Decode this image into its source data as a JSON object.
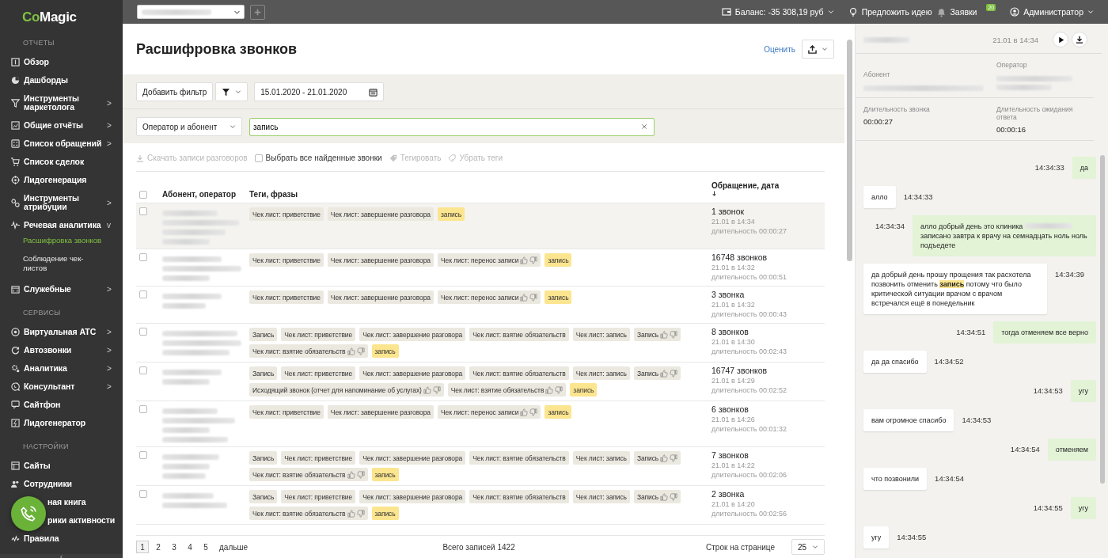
{
  "sidebar": {
    "logo_accent": "Co",
    "logo_rest": "Magic",
    "sections": [
      {
        "title": "ОТЧЕТЫ",
        "items": [
          {
            "label": "Обзор"
          },
          {
            "label": "Дашборды"
          },
          {
            "label": "Инструменты маркетолога",
            "chevron": ">"
          },
          {
            "label": "Общие отчёты",
            "chevron": ">"
          },
          {
            "label": "Список обращений",
            "chevron": ">"
          },
          {
            "label": "Список сделок"
          },
          {
            "label": "Лидогенерация"
          },
          {
            "label": "Инструменты атрибуции",
            "chevron": ">"
          },
          {
            "label": "Речевая аналитика",
            "chevron": "v",
            "children": [
              {
                "label": "Расшифровка звонков",
                "selected": true
              },
              {
                "label": "Соблюдение чек-листов",
                "selected": false
              }
            ]
          },
          {
            "label": "Служебные",
            "chevron": ">"
          }
        ]
      },
      {
        "title": "СЕРВИСЫ",
        "items": [
          {
            "label": "Виртуальная АТС",
            "chevron": ">"
          },
          {
            "label": "Автозвонки",
            "chevron": ">"
          },
          {
            "label": "Аналитика",
            "chevron": ">"
          },
          {
            "label": "Консультант",
            "chevron": ">"
          },
          {
            "label": "Сайтфон"
          },
          {
            "label": "Лидогенератор"
          }
        ]
      },
      {
        "title": "НАСТРОЙКИ",
        "items": [
          {
            "label": "Сайты",
            "covered": false
          },
          {
            "label": "Сотрудники",
            "covered": false
          },
          {
            "label": "ная книга",
            "covered": true
          },
          {
            "label": "рики активности",
            "covered": true
          },
          {
            "label": "Правила",
            "covered": false
          }
        ]
      }
    ],
    "collapse": "‹"
  },
  "topbar": {
    "balance": "Баланс: -35 308,19 руб",
    "idea": "Предложить идею",
    "requests": "Заявки",
    "requests_badge": "20",
    "user": "Администратор"
  },
  "page": {
    "title": "Расшифровка звонков",
    "rate_link": "Оценить",
    "filters": {
      "add_filter": "Добавить фильтр",
      "date_range": "15.01.2020 - 21.01.2020",
      "scope": "Оператор и абонент",
      "search_value": "запись"
    },
    "actions": [
      {
        "label": "Скачать записи разговоров",
        "kind": "download",
        "disabled": true
      },
      {
        "label": "Выбрать все найденные звонки",
        "kind": "checkbox",
        "checked": false,
        "disabled": false
      },
      {
        "label": "Тегировать",
        "kind": "tag",
        "disabled": true
      },
      {
        "label": "Убрать теги",
        "kind": "untag",
        "disabled": true
      }
    ],
    "table": {
      "select_all_checked": false,
      "columns": [
        "Абонент, оператор",
        "Теги, фразы",
        "Обращение, дата"
      ],
      "rows": [
        {
          "selected": true,
          "checked": false,
          "tags": [
            {
              "text": "Чек лист: приветствие",
              "kind": "plain",
              "rating": false
            },
            {
              "text": "Чек лист: завершение разговора",
              "kind": "plain",
              "rating": false
            },
            {
              "text": "запись",
              "kind": "match",
              "rating": false
            }
          ],
          "count": "1 звонок",
          "date": "21.01 в 14:34",
          "duration": "длительность 00:00:27"
        },
        {
          "selected": false,
          "checked": false,
          "tags": [
            {
              "text": "Чек лист: приветствие",
              "kind": "plain",
              "rating": false
            },
            {
              "text": "Чек лист: завершение разговора",
              "kind": "plain",
              "rating": false
            },
            {
              "text": "Чек лист: перенос записи",
              "kind": "plain",
              "rating": true
            },
            {
              "text": "запись",
              "kind": "match",
              "rating": false
            }
          ],
          "count": "16748 звонков",
          "date": "21.01 в 14:32",
          "duration": "длительность 00:00:51"
        },
        {
          "selected": false,
          "checked": false,
          "tags": [
            {
              "text": "Чек лист: приветствие",
              "kind": "plain",
              "rating": false
            },
            {
              "text": "Чек лист: завершение разговора",
              "kind": "plain",
              "rating": false
            },
            {
              "text": "Чек лист: перенос записи",
              "kind": "plain",
              "rating": true
            },
            {
              "text": "запись",
              "kind": "match",
              "rating": false
            }
          ],
          "count": "3 звонка",
          "date": "21.01 в 14:32",
          "duration": "длительность 00:00:43"
        },
        {
          "selected": false,
          "checked": false,
          "tags": [
            {
              "text": "Запись",
              "kind": "plain",
              "rating": false
            },
            {
              "text": "Чек лист: приветствие",
              "kind": "plain",
              "rating": false
            },
            {
              "text": "Чек лист: завершение разговора",
              "kind": "plain",
              "rating": false
            },
            {
              "text": "Чек лист: взятие обязательств",
              "kind": "plain",
              "rating": false
            },
            {
              "text": "Чек лист: запись",
              "kind": "plain",
              "rating": false
            },
            {
              "text": "Запись",
              "kind": "plain",
              "rating": true
            },
            {
              "text": "Чек лист: взятие обязательств",
              "kind": "plain",
              "rating": true
            },
            {
              "text": "запись",
              "kind": "match",
              "rating": false
            }
          ],
          "count": "8 звонков",
          "date": "21.01 в 14:30",
          "duration": "длительность 00:02:43"
        },
        {
          "selected": false,
          "checked": false,
          "tags": [
            {
              "text": "Запись",
              "kind": "plain",
              "rating": false
            },
            {
              "text": "Чек лист: приветствие",
              "kind": "plain",
              "rating": false
            },
            {
              "text": "Чек лист: завершение разговора",
              "kind": "plain",
              "rating": false
            },
            {
              "text": "Чек лист: взятие обязательств",
              "kind": "plain",
              "rating": false
            },
            {
              "text": "Чек лист: запись",
              "kind": "plain",
              "rating": false
            },
            {
              "text": "Запись",
              "kind": "plain",
              "rating": true
            },
            {
              "text": "Исходящий звонок (отчет для напоминание об услугах)",
              "kind": "plain",
              "rating": true
            },
            {
              "text": "Чек лист: взятие обязательств",
              "kind": "plain",
              "rating": true
            },
            {
              "text": "запись",
              "kind": "match",
              "rating": false
            }
          ],
          "count": "16747 звонков",
          "date": "21.01 в 14:29",
          "duration": "длительность 00:02:52"
        },
        {
          "selected": false,
          "checked": false,
          "tags": [
            {
              "text": "Чек лист: приветствие",
              "kind": "plain",
              "rating": false
            },
            {
              "text": "Чек лист: завершение разговора",
              "kind": "plain",
              "rating": false
            },
            {
              "text": "Чек лист: перенос записи",
              "kind": "plain",
              "rating": true
            },
            {
              "text": "запись",
              "kind": "match",
              "rating": false
            }
          ],
          "count": "6 звонков",
          "date": "21.01 в 14:26",
          "duration": "длительность 00:01:32"
        },
        {
          "selected": false,
          "checked": false,
          "tags": [
            {
              "text": "Запись",
              "kind": "plain",
              "rating": false
            },
            {
              "text": "Чек лист: приветствие",
              "kind": "plain",
              "rating": false
            },
            {
              "text": "Чек лист: завершение разговора",
              "kind": "plain",
              "rating": false
            },
            {
              "text": "Чек лист: взятие обязательств",
              "kind": "plain",
              "rating": false
            },
            {
              "text": "Чек лист: запись",
              "kind": "plain",
              "rating": false
            },
            {
              "text": "Запись",
              "kind": "plain",
              "rating": true
            },
            {
              "text": "Чек лист: взятие обязательств",
              "kind": "plain",
              "rating": true
            },
            {
              "text": "запись",
              "kind": "match",
              "rating": false
            }
          ],
          "count": "7 звонков",
          "date": "21.01 в 14:22",
          "duration": "длительность 00:02:06"
        },
        {
          "selected": false,
          "checked": false,
          "tags": [
            {
              "text": "Запись",
              "kind": "plain",
              "rating": false
            },
            {
              "text": "Чек лист: приветствие",
              "kind": "plain",
              "rating": false
            },
            {
              "text": "Чек лист: завершение разговора",
              "kind": "plain",
              "rating": false
            },
            {
              "text": "Чек лист: взятие обязательств",
              "kind": "plain",
              "rating": false
            },
            {
              "text": "Чек лист: запись",
              "kind": "plain",
              "rating": false
            },
            {
              "text": "Запись",
              "kind": "plain",
              "rating": true
            },
            {
              "text": "Чек лист: взятие обязательств",
              "kind": "plain",
              "rating": true
            },
            {
              "text": "запись",
              "kind": "match",
              "rating": false
            }
          ],
          "count": "2 звонка",
          "date": "21.01 в 14:20",
          "duration": "длительность 00:02:56"
        }
      ]
    },
    "pagination": {
      "pages": [
        {
          "label": "1",
          "selected": true
        },
        {
          "label": "2",
          "selected": false
        },
        {
          "label": "3",
          "selected": false
        },
        {
          "label": "4",
          "selected": false
        },
        {
          "label": "5",
          "selected": false
        }
      ],
      "next": "дальше",
      "total": "Всего записей 1422",
      "rows_label": "Строк на странице",
      "rows_value": "25"
    }
  },
  "detail": {
    "datetime": "21.01 в 14:34",
    "subscriber_label": "Абонент",
    "operator_label": "Оператор",
    "call_duration_label": "Длительность звонка",
    "call_duration": "00:00:27",
    "wait_label": "Длительность ожидания ответа",
    "wait": "00:00:16",
    "messages": [
      {
        "kind": "operator",
        "text": "да",
        "time": "14:34:33"
      },
      {
        "kind": "client",
        "text": "алло",
        "time": "14:34:33"
      },
      {
        "kind": "operator",
        "text": "алло добрый день это клиника",
        "continuation": "записано завтра к врачу на семнадцать ноль ноль подъедете",
        "time": "14:34:34"
      },
      {
        "kind": "client",
        "text": "да добрый день прошу прощения так расхотела позвонить отменить **запись** потому что было критической ситуации врачом с врачом встречался ещё в понедельник",
        "time": "14:34:39"
      },
      {
        "kind": "operator",
        "text": "тогда отменяем все верно",
        "time": "14:34:51"
      },
      {
        "kind": "client",
        "text": "да да спасибо",
        "time": "14:34:52"
      },
      {
        "kind": "operator",
        "text": "угу",
        "time": "14:34:53"
      },
      {
        "kind": "client",
        "text": "вам огромное спасибо",
        "time": "14:34:53"
      },
      {
        "kind": "operator",
        "text": "отменяем",
        "time": "14:34:54"
      },
      {
        "kind": "client",
        "text": "что позвонили",
        "time": "14:34:54"
      },
      {
        "kind": "operator",
        "text": "угу",
        "time": "14:34:55"
      },
      {
        "kind": "client",
        "text": "угу",
        "time": "14:34:55"
      }
    ]
  }
}
